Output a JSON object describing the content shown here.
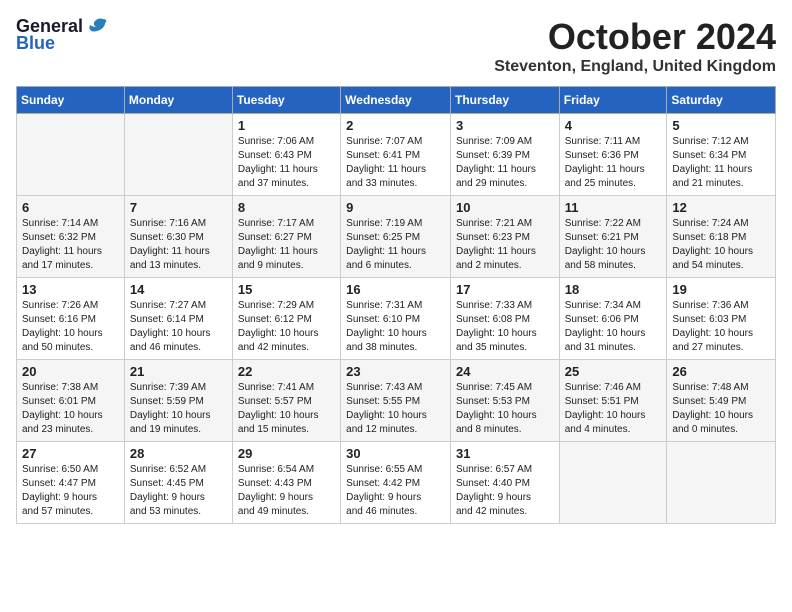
{
  "logo": {
    "general": "General",
    "blue": "Blue"
  },
  "title": "October 2024",
  "location": "Steventon, England, United Kingdom",
  "headers": [
    "Sunday",
    "Monday",
    "Tuesday",
    "Wednesday",
    "Thursday",
    "Friday",
    "Saturday"
  ],
  "weeks": [
    [
      {
        "day": "",
        "detail": ""
      },
      {
        "day": "",
        "detail": ""
      },
      {
        "day": "1",
        "detail": "Sunrise: 7:06 AM\nSunset: 6:43 PM\nDaylight: 11 hours\nand 37 minutes."
      },
      {
        "day": "2",
        "detail": "Sunrise: 7:07 AM\nSunset: 6:41 PM\nDaylight: 11 hours\nand 33 minutes."
      },
      {
        "day": "3",
        "detail": "Sunrise: 7:09 AM\nSunset: 6:39 PM\nDaylight: 11 hours\nand 29 minutes."
      },
      {
        "day": "4",
        "detail": "Sunrise: 7:11 AM\nSunset: 6:36 PM\nDaylight: 11 hours\nand 25 minutes."
      },
      {
        "day": "5",
        "detail": "Sunrise: 7:12 AM\nSunset: 6:34 PM\nDaylight: 11 hours\nand 21 minutes."
      }
    ],
    [
      {
        "day": "6",
        "detail": "Sunrise: 7:14 AM\nSunset: 6:32 PM\nDaylight: 11 hours\nand 17 minutes."
      },
      {
        "day": "7",
        "detail": "Sunrise: 7:16 AM\nSunset: 6:30 PM\nDaylight: 11 hours\nand 13 minutes."
      },
      {
        "day": "8",
        "detail": "Sunrise: 7:17 AM\nSunset: 6:27 PM\nDaylight: 11 hours\nand 9 minutes."
      },
      {
        "day": "9",
        "detail": "Sunrise: 7:19 AM\nSunset: 6:25 PM\nDaylight: 11 hours\nand 6 minutes."
      },
      {
        "day": "10",
        "detail": "Sunrise: 7:21 AM\nSunset: 6:23 PM\nDaylight: 11 hours\nand 2 minutes."
      },
      {
        "day": "11",
        "detail": "Sunrise: 7:22 AM\nSunset: 6:21 PM\nDaylight: 10 hours\nand 58 minutes."
      },
      {
        "day": "12",
        "detail": "Sunrise: 7:24 AM\nSunset: 6:18 PM\nDaylight: 10 hours\nand 54 minutes."
      }
    ],
    [
      {
        "day": "13",
        "detail": "Sunrise: 7:26 AM\nSunset: 6:16 PM\nDaylight: 10 hours\nand 50 minutes."
      },
      {
        "day": "14",
        "detail": "Sunrise: 7:27 AM\nSunset: 6:14 PM\nDaylight: 10 hours\nand 46 minutes."
      },
      {
        "day": "15",
        "detail": "Sunrise: 7:29 AM\nSunset: 6:12 PM\nDaylight: 10 hours\nand 42 minutes."
      },
      {
        "day": "16",
        "detail": "Sunrise: 7:31 AM\nSunset: 6:10 PM\nDaylight: 10 hours\nand 38 minutes."
      },
      {
        "day": "17",
        "detail": "Sunrise: 7:33 AM\nSunset: 6:08 PM\nDaylight: 10 hours\nand 35 minutes."
      },
      {
        "day": "18",
        "detail": "Sunrise: 7:34 AM\nSunset: 6:06 PM\nDaylight: 10 hours\nand 31 minutes."
      },
      {
        "day": "19",
        "detail": "Sunrise: 7:36 AM\nSunset: 6:03 PM\nDaylight: 10 hours\nand 27 minutes."
      }
    ],
    [
      {
        "day": "20",
        "detail": "Sunrise: 7:38 AM\nSunset: 6:01 PM\nDaylight: 10 hours\nand 23 minutes."
      },
      {
        "day": "21",
        "detail": "Sunrise: 7:39 AM\nSunset: 5:59 PM\nDaylight: 10 hours\nand 19 minutes."
      },
      {
        "day": "22",
        "detail": "Sunrise: 7:41 AM\nSunset: 5:57 PM\nDaylight: 10 hours\nand 15 minutes."
      },
      {
        "day": "23",
        "detail": "Sunrise: 7:43 AM\nSunset: 5:55 PM\nDaylight: 10 hours\nand 12 minutes."
      },
      {
        "day": "24",
        "detail": "Sunrise: 7:45 AM\nSunset: 5:53 PM\nDaylight: 10 hours\nand 8 minutes."
      },
      {
        "day": "25",
        "detail": "Sunrise: 7:46 AM\nSunset: 5:51 PM\nDaylight: 10 hours\nand 4 minutes."
      },
      {
        "day": "26",
        "detail": "Sunrise: 7:48 AM\nSunset: 5:49 PM\nDaylight: 10 hours\nand 0 minutes."
      }
    ],
    [
      {
        "day": "27",
        "detail": "Sunrise: 6:50 AM\nSunset: 4:47 PM\nDaylight: 9 hours\nand 57 minutes."
      },
      {
        "day": "28",
        "detail": "Sunrise: 6:52 AM\nSunset: 4:45 PM\nDaylight: 9 hours\nand 53 minutes."
      },
      {
        "day": "29",
        "detail": "Sunrise: 6:54 AM\nSunset: 4:43 PM\nDaylight: 9 hours\nand 49 minutes."
      },
      {
        "day": "30",
        "detail": "Sunrise: 6:55 AM\nSunset: 4:42 PM\nDaylight: 9 hours\nand 46 minutes."
      },
      {
        "day": "31",
        "detail": "Sunrise: 6:57 AM\nSunset: 4:40 PM\nDaylight: 9 hours\nand 42 minutes."
      },
      {
        "day": "",
        "detail": ""
      },
      {
        "day": "",
        "detail": ""
      }
    ]
  ]
}
